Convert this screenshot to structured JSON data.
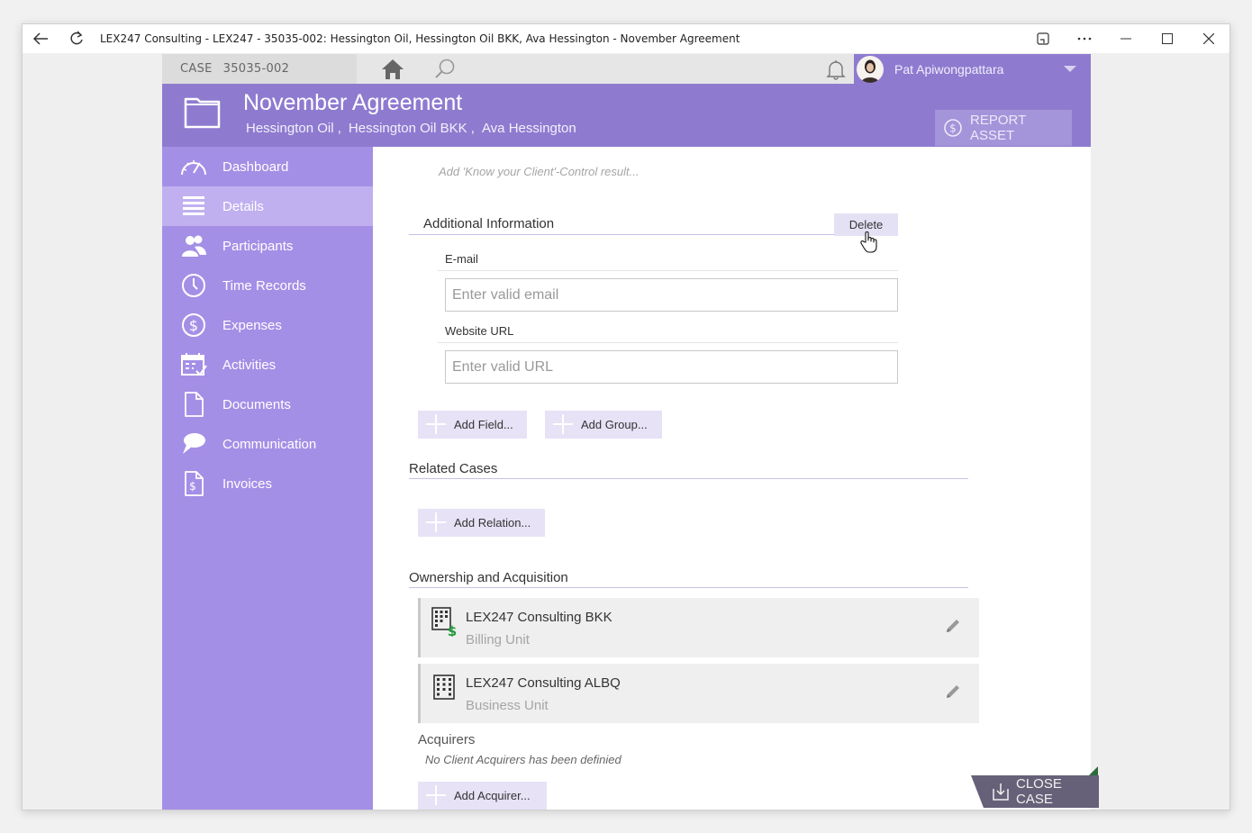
{
  "window": {
    "title": "LEX247 Consulting - LEX247 - 35035-002: Hessington Oil, Hessington Oil BKK, Ava Hessington - November Agreement",
    "icons": [
      "back-icon",
      "refresh-icon",
      "cast-icon",
      "more-icon",
      "minimize-icon",
      "maximize-icon",
      "close-icon"
    ]
  },
  "topbar": {
    "case_label": "CASE",
    "case_number": "35035-002",
    "user_name": "Pat Apiwongpattara"
  },
  "header": {
    "title": "November Agreement",
    "clients": [
      "Hessington Oil ,",
      "Hessington Oil BKK ,",
      "Ava Hessington"
    ],
    "report_button": "REPORT ASSET"
  },
  "sidebar": {
    "items": [
      {
        "label": "Dashboard",
        "icon": "gauge-icon"
      },
      {
        "label": "Details",
        "icon": "list-icon",
        "active": true
      },
      {
        "label": "Participants",
        "icon": "people-icon"
      },
      {
        "label": "Time Records",
        "icon": "clock-icon"
      },
      {
        "label": "Expenses",
        "icon": "dollar-icon"
      },
      {
        "label": "Activities",
        "icon": "calendar-icon"
      },
      {
        "label": "Documents",
        "icon": "document-icon"
      },
      {
        "label": "Communication",
        "icon": "chat-icon"
      },
      {
        "label": "Invoices",
        "icon": "invoice-icon"
      }
    ]
  },
  "content": {
    "kyc_placeholder": "Add 'Know your Client'-Control result...",
    "additional_info": {
      "title": "Additional Information",
      "delete_label": "Delete",
      "fields": [
        {
          "label": "E-mail",
          "placeholder": "Enter valid email"
        },
        {
          "label": "Website URL",
          "placeholder": "Enter valid URL"
        }
      ],
      "add_field": "Add Field...",
      "add_group": "Add Group..."
    },
    "related_cases": {
      "title": "Related Cases",
      "add_relation": "Add Relation..."
    },
    "ownership": {
      "title": "Ownership and Acquisition",
      "units": [
        {
          "name": "LEX247 Consulting BKK",
          "type": "Billing Unit",
          "icon": "billing-building-icon"
        },
        {
          "name": "LEX247 Consulting ALBQ",
          "type": "Business Unit",
          "icon": "building-icon"
        }
      ],
      "acquirers_title": "Acquirers",
      "acquirers_empty": "No Client Acquirers has been definied",
      "add_acquirer": "Add Acquirer..."
    },
    "close_case": "CLOSE CASE"
  },
  "colors": {
    "accent": "#8e7bd0",
    "sidebar": "#a48fe6",
    "sidebar_active": "#c0b0f0",
    "button_bg": "#e7e2f6"
  }
}
